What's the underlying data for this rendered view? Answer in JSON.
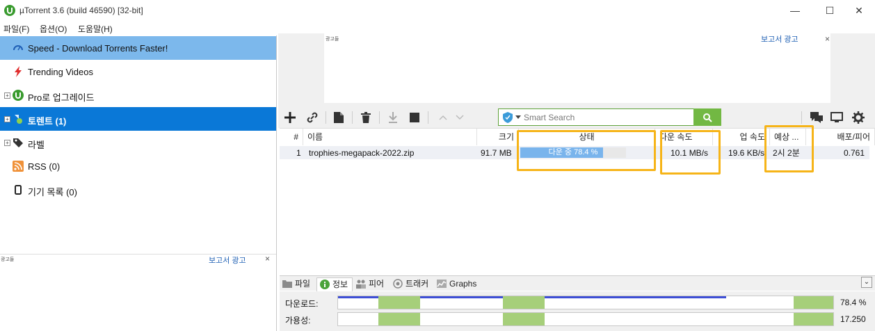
{
  "window": {
    "title": "µTorrent 3.6  (build 46590) [32-bit]",
    "minimize": "—",
    "maximize": "☐",
    "close": "✕"
  },
  "menu": [
    "파일(F)",
    "옵션(O)",
    "도움말(H)"
  ],
  "sidebar": {
    "items": [
      {
        "label": "Speed - Download Torrents Faster!",
        "icon": "speed-gauge-icon",
        "state": "highlighted"
      },
      {
        "label": "Trending Videos",
        "icon": "lightning-icon"
      },
      {
        "label": "Pro로 업그레이드",
        "icon": "utorrent-logo-icon",
        "expand": "+"
      },
      {
        "label": "토렌트 (1)",
        "icon": "torrent-icon",
        "expand": "+",
        "state": "selected"
      },
      {
        "label": "라벨",
        "icon": "tag-icon",
        "expand": "+"
      },
      {
        "label": "RSS (0)",
        "icon": "rss-icon"
      },
      {
        "label": "기기 목록 (0)",
        "icon": "device-icon"
      }
    ],
    "ad_tag": "광고들",
    "ad_report": "보고서 광고"
  },
  "ad_top": {
    "tag": "광고들",
    "report": "보고서 광고",
    "close": "×"
  },
  "toolbar": {
    "search_placeholder": "Smart Search"
  },
  "list": {
    "columns": [
      "#",
      "이름",
      "크기",
      "상태",
      "다운 속도",
      "업 속도",
      "예상 ...",
      "배포/피어"
    ],
    "rows": [
      {
        "num": "1",
        "name": "trophies-megapack-2022.zip",
        "size": "91.7 MB",
        "status": "다운 중 78.4 %",
        "progress": 0.784,
        "down_speed": "10.1 MB/s",
        "up_speed": "19.6 KB/s",
        "eta": "2시 2분",
        "ratio": "0.761"
      }
    ]
  },
  "tabs": [
    "파일",
    "정보",
    "피어",
    "트래커",
    "Graphs"
  ],
  "tab_active": "정보",
  "collapse": "⌄",
  "info": {
    "downloaded_label": "다운로드:",
    "downloaded_value": "78.4 %",
    "availability_label": "가용성:",
    "availability_value": "17.250"
  },
  "colors": {
    "accent": "#0a78d7",
    "highlight_box": "#f6b418",
    "search_green": "#72b843",
    "progress_fill": "#79b4ec",
    "piece_green": "#a6cf7a"
  }
}
